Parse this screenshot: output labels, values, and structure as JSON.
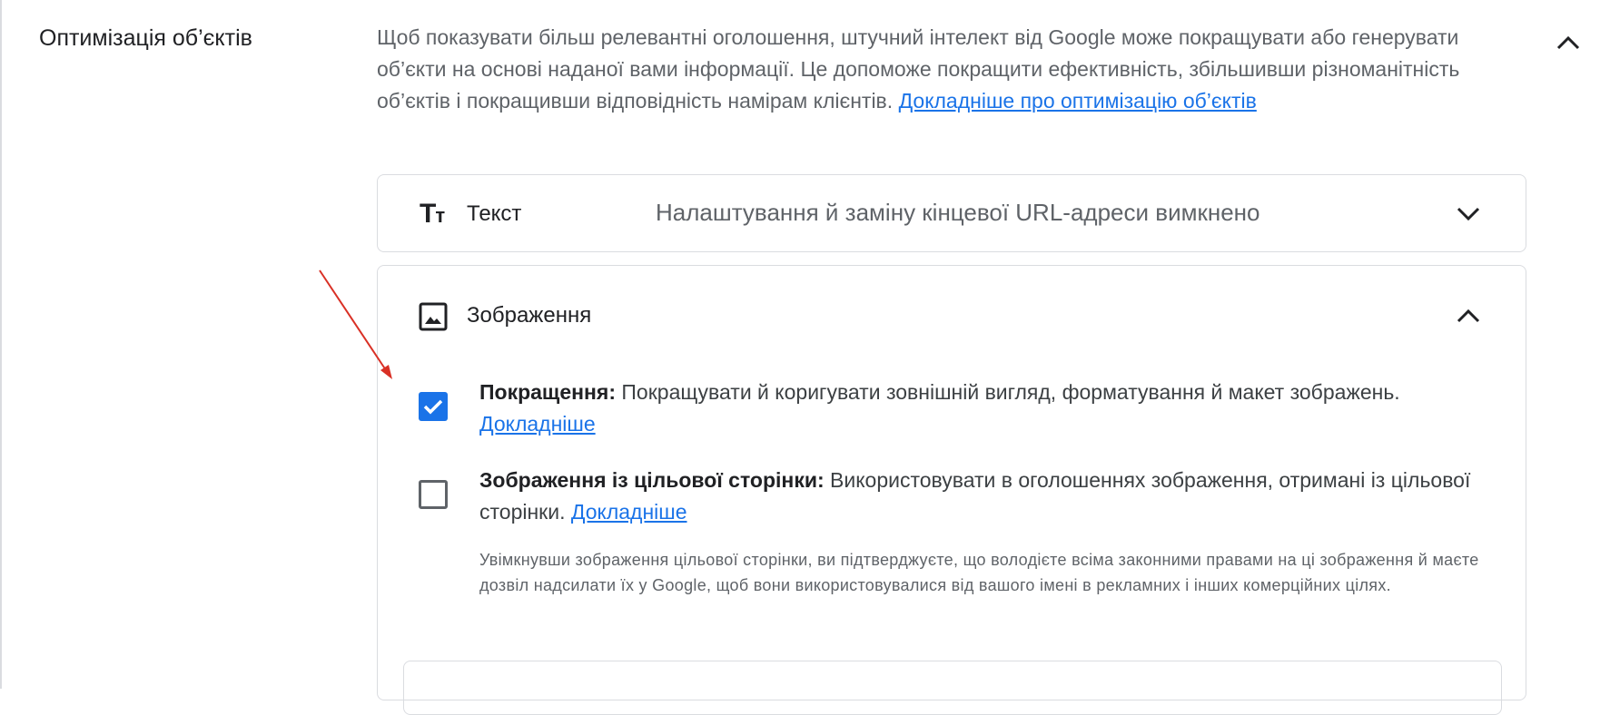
{
  "section": {
    "title": "Оптимізація об’єктів",
    "description": "Щоб показувати більш релевантні оголошення, штучний інтелект від Google може покращувати або генерувати об’єкти на основі наданої вами інформації. Це допоможе покращити ефективність, збільшивши різноманітність об’єктів і покращивши відповідність намірам клієнтів.",
    "learn_more_link": "Докладніше про оптимізацію об’єктів"
  },
  "text_card": {
    "icon": "text-format-icon",
    "icon_glyph": "Tт",
    "label": "Текст",
    "status": "Налаштування й заміну кінцевої URL-адреси вимкнено"
  },
  "image_card": {
    "icon": "image-icon",
    "label": "Зображення",
    "options": [
      {
        "checked": true,
        "title": "Покращення:",
        "text": "Покращувати й коригувати зовнішній вигляд, форматування й макет зображень.",
        "link": "Докладніше"
      },
      {
        "checked": false,
        "title": "Зображення із цільової сторінки:",
        "text": "Використовувати в оголошеннях зображення, отримані із цільової сторінки.",
        "link": "Докладніше",
        "note": "Увімкнувши зображення цільової сторінки, ви підтверджуєте, що володієте всіма законними правами на ці зображення й маєте дозвіл надсилати їх у Google, щоб вони використовувалися від вашого імені в рекламних і інших комерційних цілях."
      }
    ]
  },
  "colors": {
    "accent": "#1a73e8",
    "annotation_arrow": "#d93025"
  }
}
